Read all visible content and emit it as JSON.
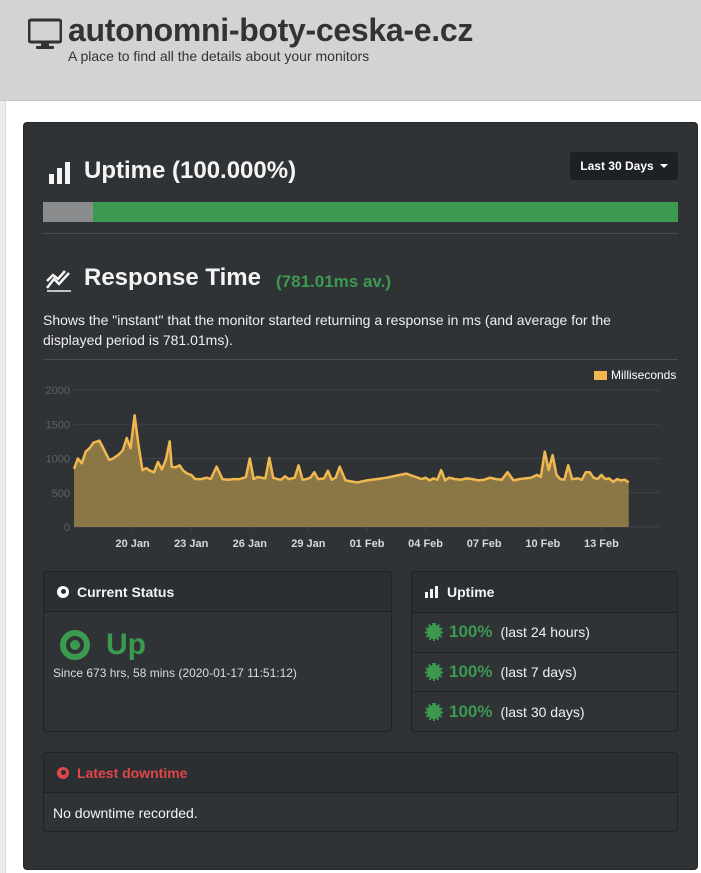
{
  "header": {
    "site_title": "autonomni-boty-ceska-e.cz",
    "subtitle": "A place to find all the details about your monitors",
    "icon": "monitor-icon"
  },
  "uptime": {
    "title": "Uptime (100.000%)",
    "range_button": "Last 30 Days",
    "bar_unmonitored_fraction": 0.079,
    "icon": "bar-chart-icon"
  },
  "response_time": {
    "title": "Response Time",
    "average": "(781.01ms av.)",
    "description": "Shows the \"instant\" that the monitor started returning a response in ms (and average for the displayed period is 781.01ms).",
    "icon": "line-chart-icon"
  },
  "chart_data": {
    "type": "area",
    "legend": [
      "Milliseconds"
    ],
    "legend_position": "top-right",
    "color": "#f0b84e",
    "ylim": [
      0,
      2000
    ],
    "yticks": [
      "0",
      "500",
      "1000",
      "1500",
      "2000"
    ],
    "xlim": [
      0,
      30
    ],
    "xticks": [
      {
        "x": 3,
        "label": "20 Jan"
      },
      {
        "x": 6,
        "label": "23 Jan"
      },
      {
        "x": 9,
        "label": "26 Jan"
      },
      {
        "x": 12,
        "label": "29 Jan"
      },
      {
        "x": 15,
        "label": "01 Feb"
      },
      {
        "x": 18,
        "label": "04 Feb"
      },
      {
        "x": 21,
        "label": "07 Feb"
      },
      {
        "x": 24,
        "label": "10 Feb"
      },
      {
        "x": 27,
        "label": "13 Feb"
      }
    ],
    "series": [
      {
        "name": "Milliseconds",
        "x": [
          0,
          0.2,
          0.4,
          0.6,
          0.8,
          1.0,
          1.3,
          1.5,
          1.8,
          2.0,
          2.3,
          2.5,
          2.7,
          2.9,
          3.1,
          3.3,
          3.5,
          3.7,
          3.9,
          4.1,
          4.3,
          4.5,
          4.7,
          4.9,
          5.0,
          5.2,
          5.4,
          5.6,
          5.8,
          6.0,
          6.2,
          6.5,
          6.8,
          7.0,
          7.3,
          7.6,
          7.9,
          8.2,
          8.5,
          8.8,
          9.0,
          9.2,
          9.4,
          9.6,
          9.8,
          10.0,
          10.2,
          10.4,
          10.6,
          10.8,
          11.0,
          11.3,
          11.5,
          11.7,
          11.9,
          12.1,
          12.3,
          12.5,
          12.8,
          13.0,
          13.2,
          13.4,
          13.6,
          13.9,
          14.1,
          14.5,
          15.0,
          15.5,
          16.0,
          16.5,
          17.0,
          17.5,
          17.8,
          18.0,
          18.2,
          18.4,
          18.6,
          18.8,
          19.0,
          19.2,
          19.5,
          19.8,
          20.1,
          20.4,
          20.7,
          21.0,
          21.3,
          21.6,
          21.9,
          22.2,
          22.5,
          22.8,
          23.1,
          23.4,
          23.7,
          23.9,
          24.1,
          24.3,
          24.5,
          24.7,
          24.9,
          25.1,
          25.3,
          25.5,
          25.8,
          26.0,
          26.2,
          26.4,
          26.6,
          26.8,
          27.0,
          27.2,
          27.4,
          27.6,
          27.8,
          28.0,
          28.2,
          28.4
        ],
        "values": [
          850,
          1000,
          930,
          1100,
          1150,
          1230,
          1260,
          1150,
          980,
          1000,
          1060,
          1120,
          1300,
          1150,
          1630,
          1200,
          830,
          860,
          820,
          800,
          950,
          840,
          980,
          1250,
          880,
          870,
          900,
          820,
          780,
          760,
          700,
          700,
          720,
          700,
          880,
          700,
          690,
          700,
          700,
          730,
          1000,
          700,
          730,
          720,
          710,
          1010,
          720,
          700,
          690,
          740,
          700,
          720,
          900,
          690,
          700,
          720,
          800,
          700,
          710,
          820,
          690,
          720,
          880,
          680,
          670,
          650,
          680,
          700,
          720,
          750,
          780,
          730,
          700,
          720,
          680,
          710,
          690,
          830,
          680,
          720,
          700,
          690,
          710,
          700,
          680,
          690,
          720,
          700,
          690,
          800,
          680,
          700,
          710,
          720,
          760,
          730,
          1100,
          830,
          1050,
          760,
          700,
          690,
          900,
          700,
          710,
          690,
          800,
          800,
          720,
          700,
          760,
          700,
          710,
          660,
          700,
          680,
          690,
          650
        ]
      }
    ]
  },
  "current_status": {
    "header": "Current Status",
    "state": "Up",
    "since": "Since 673 hrs, 58 mins (2020-01-17 11:51:12)"
  },
  "uptime_summary": {
    "header": "Uptime",
    "rows": [
      {
        "pct": "100%",
        "period": "(last 24 hours)"
      },
      {
        "pct": "100%",
        "period": "(last 7 days)"
      },
      {
        "pct": "100%",
        "period": "(last 30 days)"
      }
    ]
  },
  "latest_downtime": {
    "header": "Latest downtime",
    "text": "No downtime recorded."
  },
  "colors": {
    "panel_bg": "#303336",
    "accent_green": "#3b9a4f",
    "chart_line": "#f0b84e",
    "downtime_red": "#e0464a"
  }
}
